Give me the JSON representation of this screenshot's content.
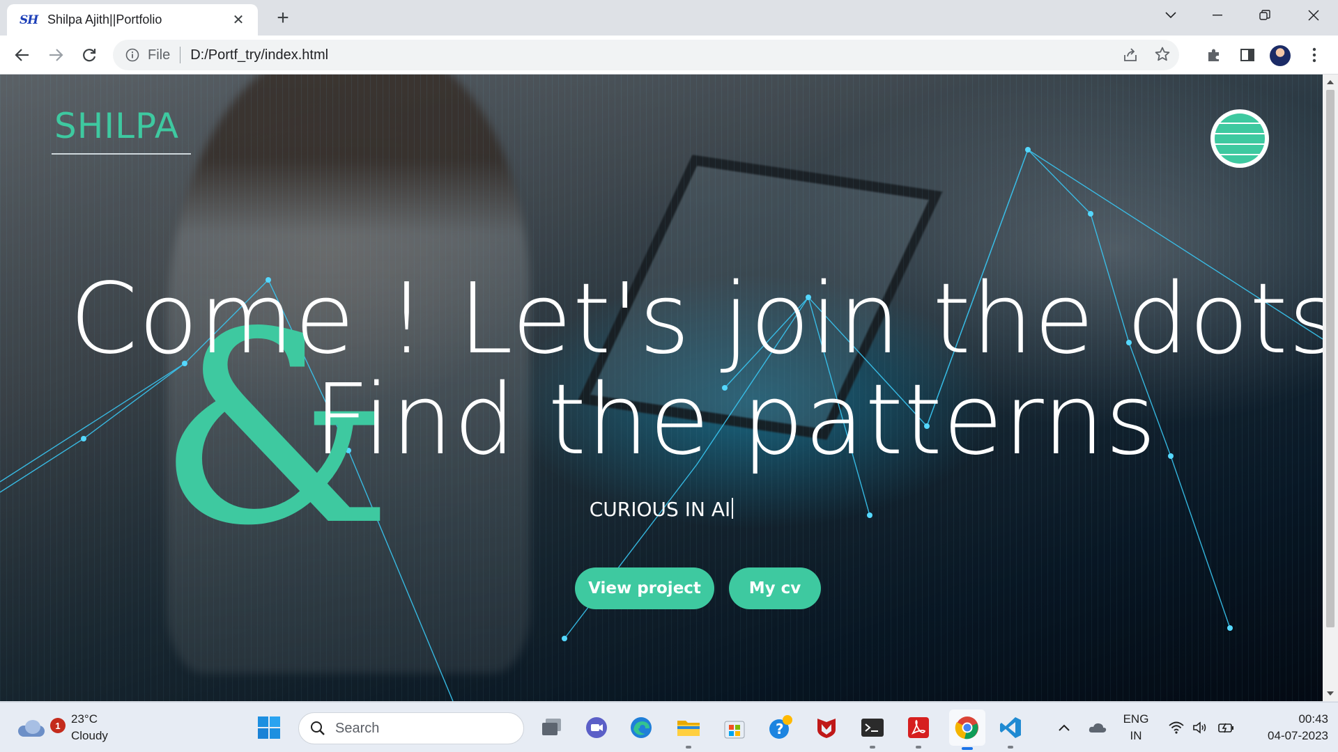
{
  "browser": {
    "tab": {
      "favicon_text": "SH",
      "title": "Shilpa Ajith||Portfolio"
    },
    "address": {
      "scheme_label": "File",
      "url": "D:/Portf_try/index.html"
    }
  },
  "page": {
    "logo": "SHILPA",
    "headline_line1": "Come ! Let's join the dots",
    "ampersand": "&",
    "headline_line2": "Find the patterns",
    "tagline": "CURIOUS IN AI",
    "buttons": {
      "view_project": "View project",
      "my_cv": "My cv"
    },
    "accent_color": "#3ec9a0"
  },
  "taskbar": {
    "weather": {
      "temp": "23°C",
      "condition": "Cloudy",
      "badge": "1"
    },
    "search_placeholder": "Search",
    "language": {
      "line1": "ENG",
      "line2": "IN"
    },
    "clock": {
      "time": "00:43",
      "date": "04-07-2023"
    },
    "apps": [
      "windows-start",
      "task-view",
      "teams-chat",
      "edge",
      "file-explorer",
      "microsoft-store",
      "get-help",
      "mcafee",
      "terminal",
      "acrobat-reader",
      "chrome",
      "vscode"
    ]
  }
}
